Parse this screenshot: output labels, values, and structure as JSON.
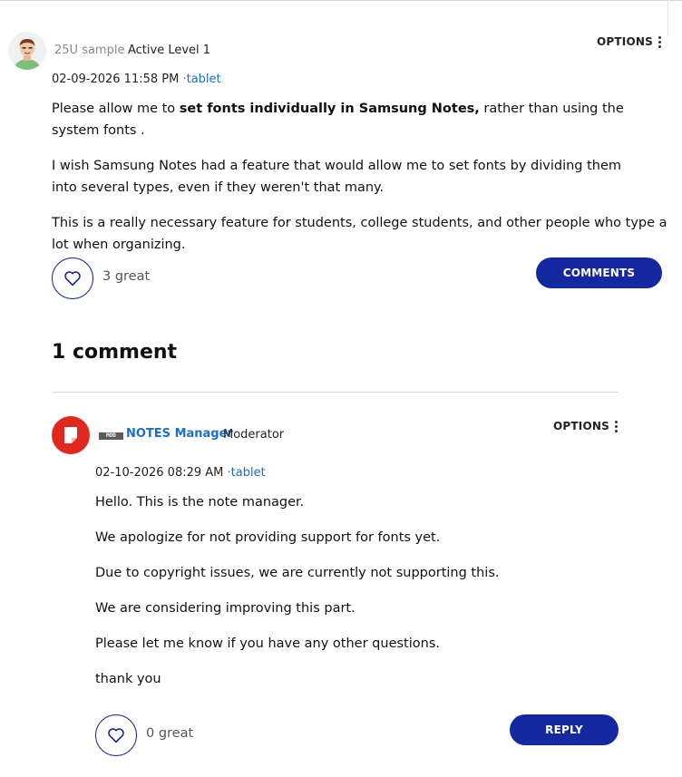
{
  "post": {
    "author": "25U sample",
    "rank": "Active Level 1",
    "options_label": "OPTIONS",
    "date": "02-09-2026 11:58 PM",
    "tag": "·tablet",
    "body": {
      "p1_before": "Please allow me to ",
      "p1_bold": "set fonts individually in Samsung Notes,",
      "p1_after": " rather than using the system fonts .",
      "p2": "I wish Samsung Notes had a feature that would allow me to set fonts by dividing them into several types, even if they weren't that many.",
      "p3": "This is a really necessary feature for students, college students, and other people who type a lot when organizing."
    },
    "likes": "3 great",
    "comments_button": "COMMENTS"
  },
  "comments_heading": "1 comment",
  "reply": {
    "badge": "MOD",
    "author": "NOTES Manager",
    "role": "Moderator",
    "options_label": "OPTIONS",
    "date": "02-10-2026 08:29 AM",
    "tag": "·tablet",
    "lines": [
      "Hello. This is the note manager.",
      "We apologize for not providing support for fonts yet.",
      "Due to copyright issues, we are currently not supporting this.",
      "We are considering improving this part.",
      "Please let me know if you have any other questions.",
      "thank you"
    ],
    "likes": "0 great",
    "reply_button": "REPLY"
  },
  "colors": {
    "accent": "#1428a0",
    "link": "#1a6fc9",
    "moderator_avatar": "#e0281e"
  },
  "icons": {
    "avatar": "user-avatar-icon",
    "options": "kebab-menu-icon",
    "like": "heart-outline-icon",
    "moderator": "notes-logo-icon"
  }
}
